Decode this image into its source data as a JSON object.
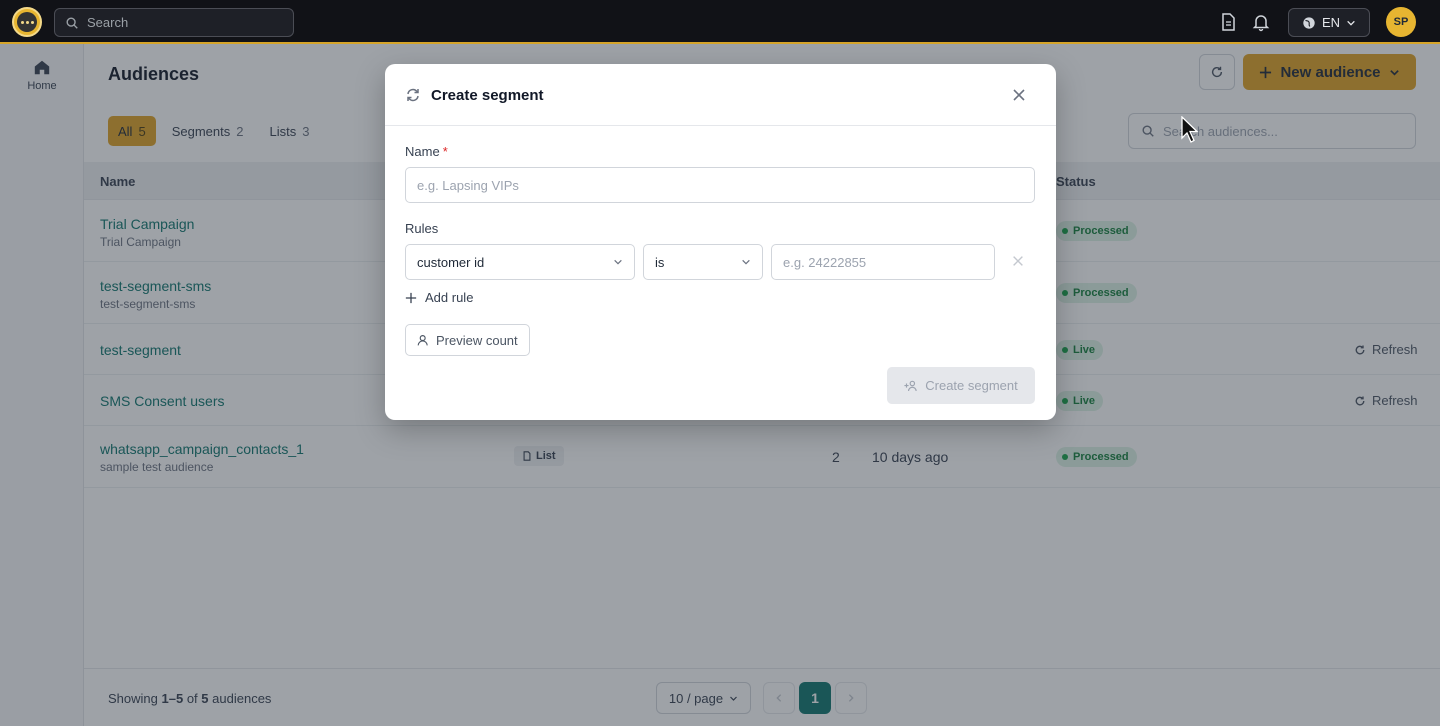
{
  "topbar": {
    "search_placeholder": "Search",
    "language": "EN",
    "user_initials": "SP"
  },
  "sidebar": {
    "home_label": "Home"
  },
  "page": {
    "title": "Audiences",
    "new_audience_label": "New audience",
    "search_placeholder": "Search audiences..."
  },
  "filters": [
    {
      "label": "All",
      "count": "5"
    },
    {
      "label": "Segments",
      "count": "2"
    },
    {
      "label": "Lists",
      "count": "3"
    }
  ],
  "table": {
    "headers": {
      "name": "Name",
      "status": "Status"
    },
    "rows": [
      {
        "name": "Trial Campaign",
        "sub": "Trial Campaign",
        "status": "Processed"
      },
      {
        "name": "test-segment-sms",
        "sub": "test-segment-sms",
        "status": "Processed"
      },
      {
        "name": "test-segment",
        "sub": "",
        "status": "Live",
        "action": "Refresh"
      },
      {
        "name": "SMS Consent users",
        "sub": "",
        "status": "Live",
        "action": "Refresh"
      },
      {
        "name": "whatsapp_campaign_contacts_1",
        "sub": "sample test audience",
        "type": "List",
        "count": "2",
        "updated": "10 days ago",
        "status": "Processed"
      }
    ]
  },
  "footer": {
    "showing_prefix": "Showing",
    "range": "1–5",
    "of": "of",
    "total": "5",
    "suffix": "audiences",
    "page_size": "10 / page",
    "current_page": "1"
  },
  "modal": {
    "title": "Create segment",
    "name_label": "Name",
    "required_mark": "*",
    "name_placeholder": "e.g. Lapsing VIPs",
    "rules_label": "Rules",
    "rule_field": "customer id",
    "rule_operator": "is",
    "rule_value_placeholder": "e.g. 24222855",
    "add_rule_label": "Add rule",
    "preview_label": "Preview count",
    "create_label": "Create segment"
  },
  "colors": {
    "accent": "#e0a326",
    "brand_teal": "#0f766e",
    "topbar": "#111217"
  }
}
